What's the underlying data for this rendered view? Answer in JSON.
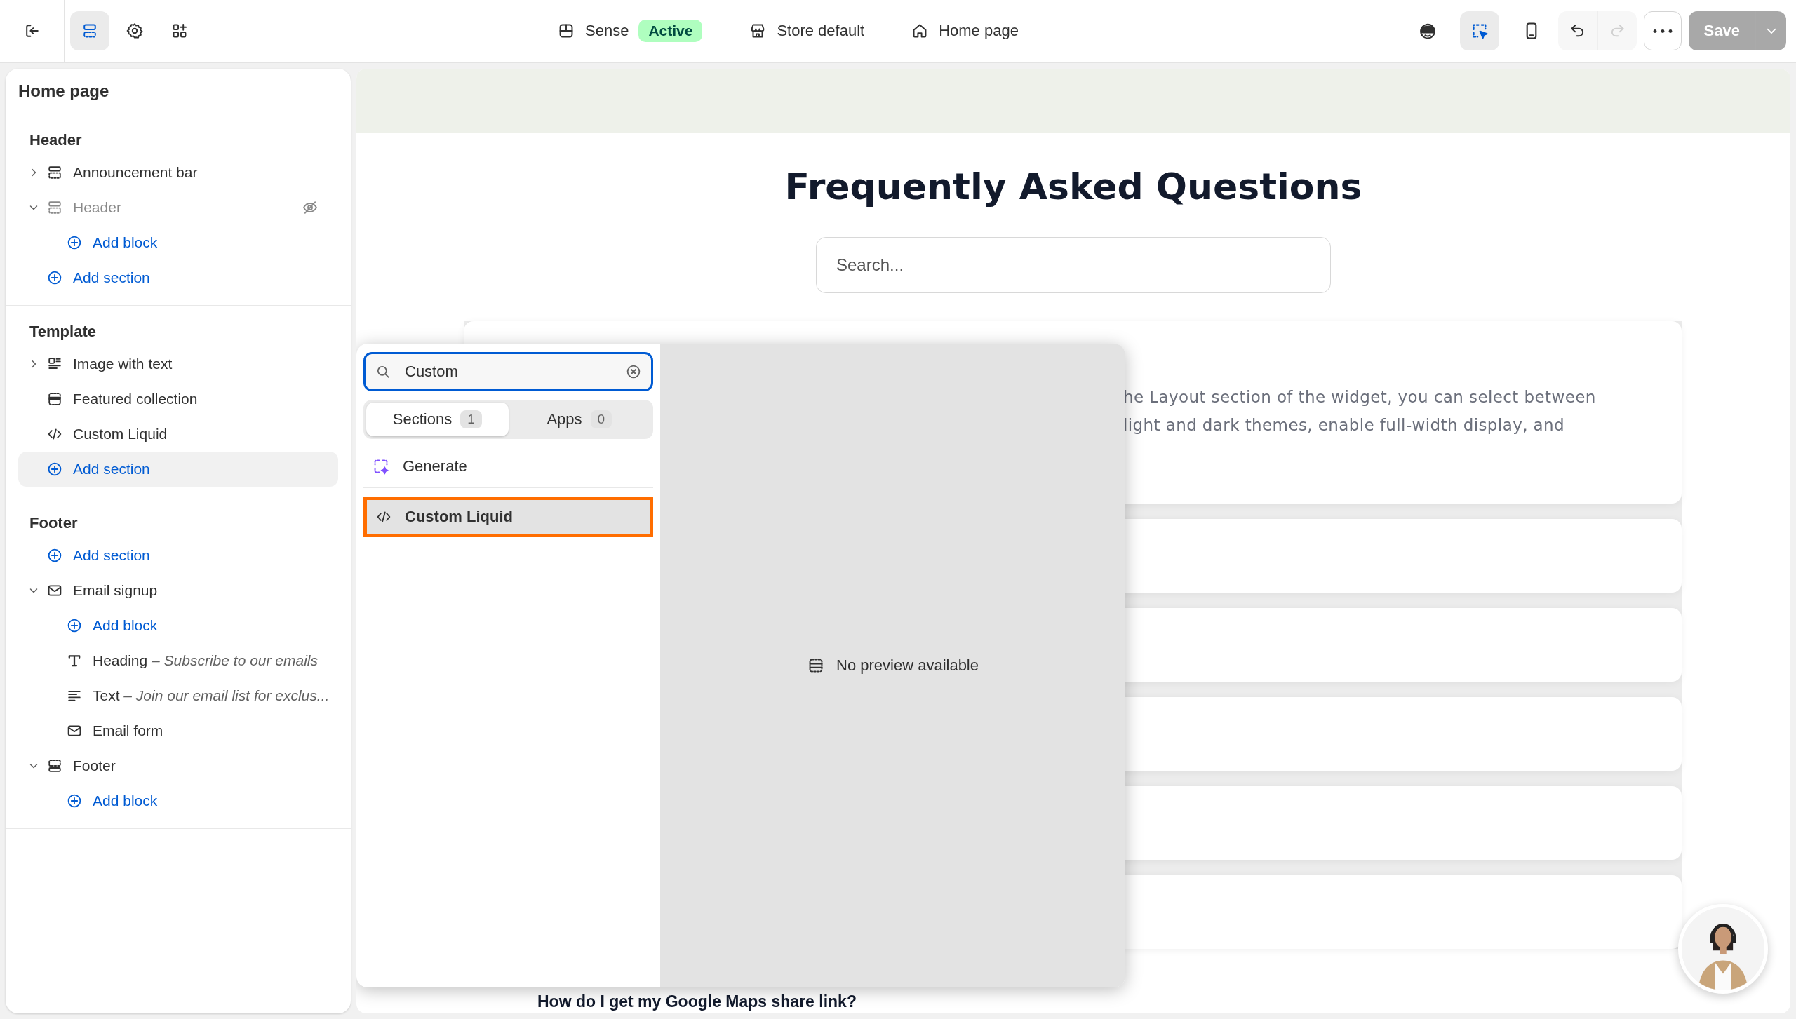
{
  "top_bar": {
    "editor_tabs": [
      {
        "selected": true
      },
      {
        "selected": false
      },
      {
        "selected": false
      }
    ],
    "theme": {
      "name": "Sense",
      "status": "Active"
    },
    "store": {
      "label": "Store default"
    },
    "page": {
      "label": "Home page"
    },
    "view_modes": [
      {
        "selected": false
      },
      {
        "selected": true
      },
      {
        "selected": false
      }
    ],
    "undo": {
      "disabled": false
    },
    "redo": {
      "disabled": true
    },
    "save": {
      "label": "Save",
      "disabled": true
    }
  },
  "sidebar": {
    "title": "Home page",
    "groups": [
      {
        "heading": "Header",
        "items": [
          {
            "kind": "section",
            "label": "Announcement bar",
            "expanded": false,
            "hidden": false,
            "selected": false
          },
          {
            "kind": "section",
            "label": "Header",
            "expanded": true,
            "hidden": true,
            "selected": false,
            "children": [
              {
                "kind": "add",
                "label": "Add block",
                "selected": false
              }
            ]
          },
          {
            "kind": "add",
            "label": "Add section",
            "selected": false
          }
        ]
      },
      {
        "heading": "Template",
        "items": [
          {
            "kind": "section",
            "label": "Image with text",
            "expanded": false,
            "hidden": false,
            "selected": false
          },
          {
            "kind": "section",
            "label": "Featured collection",
            "hidden": false,
            "selected": false
          },
          {
            "kind": "section",
            "label": "Custom Liquid",
            "hidden": false,
            "selected": false
          },
          {
            "kind": "add",
            "label": "Add section",
            "selected": true
          }
        ]
      },
      {
        "heading": "Footer",
        "items": [
          {
            "kind": "add",
            "label": "Add section",
            "selected": false
          },
          {
            "kind": "section",
            "label": "Email signup",
            "expanded": true,
            "hidden": false,
            "selected": false,
            "children": [
              {
                "kind": "add",
                "label": "Add block",
                "selected": false
              },
              {
                "kind": "block",
                "label": "Heading",
                "detail": "– Subscribe to our emails",
                "selected": false
              },
              {
                "kind": "block",
                "label": "Text",
                "detail": "– Join our email list for exclus...",
                "selected": false
              },
              {
                "kind": "block",
                "label": "Email form",
                "selected": false
              }
            ]
          },
          {
            "kind": "section",
            "label": "Footer",
            "expanded": true,
            "hidden": false,
            "selected": false,
            "children": [
              {
                "kind": "add",
                "label": "Add block",
                "selected": false
              }
            ]
          }
        ]
      }
    ]
  },
  "preview": {
    "title": "Frequently Asked Questions",
    "search": {
      "placeholder": "Search..."
    },
    "first_answer": [
      "he Layout section of the widget, you can select between",
      "light and dark themes, enable full-width display, and"
    ],
    "last_question": "How do I get my Google Maps share link?"
  },
  "picker": {
    "search": {
      "value": "Custom"
    },
    "tabs": [
      {
        "label": "Sections",
        "count": "1",
        "selected": true
      },
      {
        "label": "Apps",
        "count": "0",
        "selected": false
      }
    ],
    "actions": [
      {
        "label": "Generate"
      }
    ],
    "results": [
      {
        "label": "Custom Liquid",
        "selected": true
      }
    ],
    "preview_message": "No preview available"
  }
}
